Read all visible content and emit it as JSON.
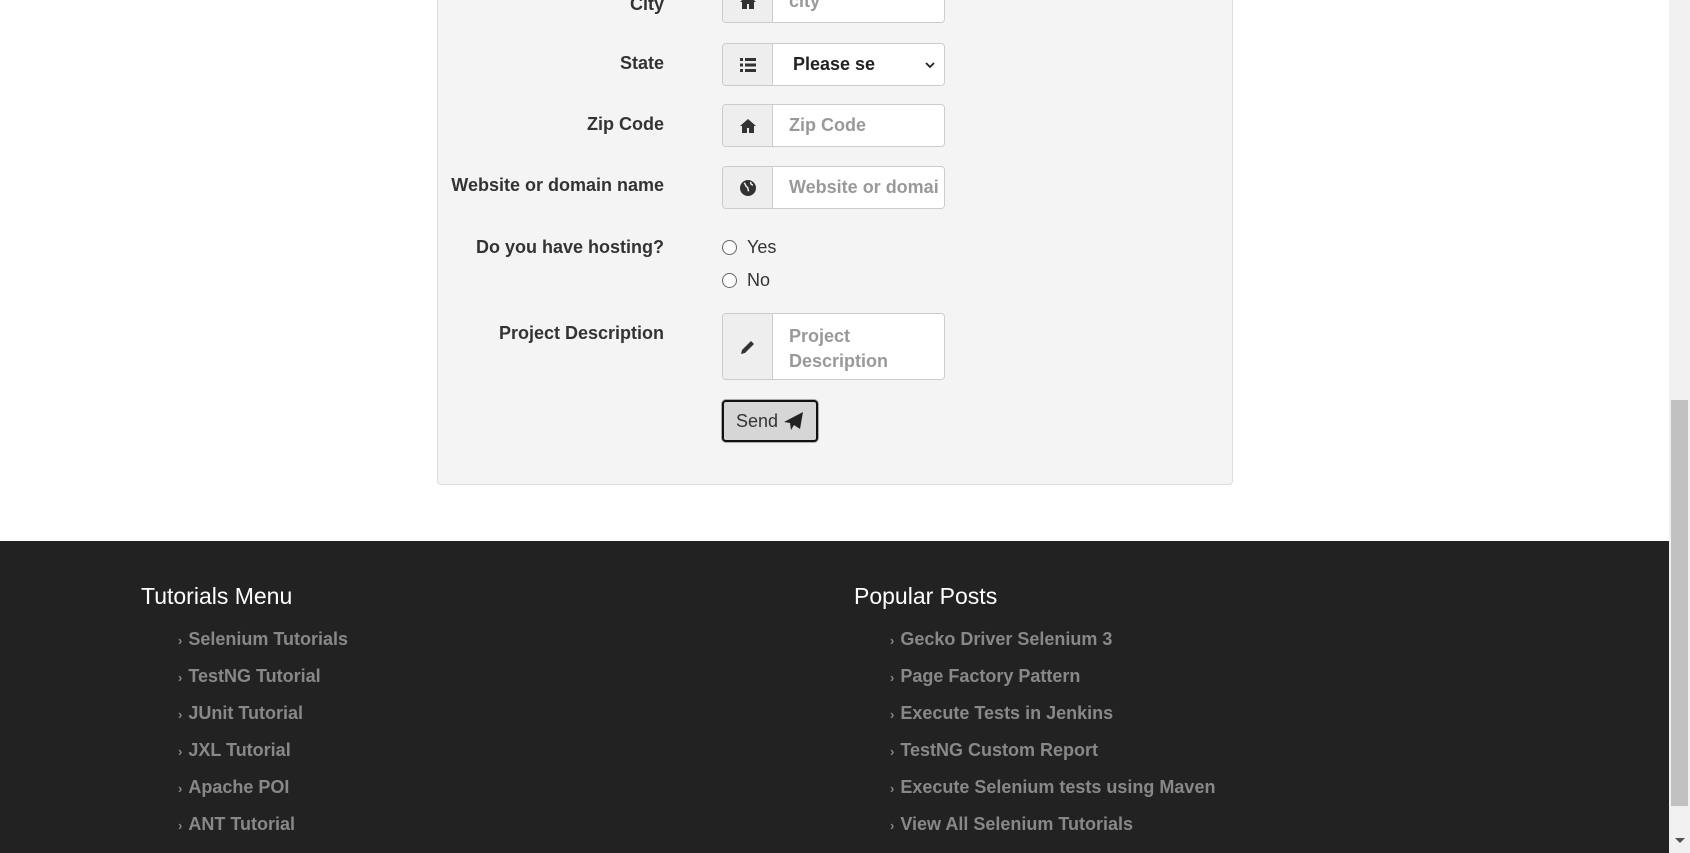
{
  "form": {
    "city": {
      "label": "City",
      "placeholder": "city"
    },
    "state": {
      "label": "State",
      "value": "Please se"
    },
    "zip": {
      "label": "Zip Code",
      "placeholder": "Zip Code"
    },
    "website": {
      "label": "Website or domain name",
      "placeholder": "Website or domai"
    },
    "hosting": {
      "label": "Do you have hosting?",
      "options": [
        "Yes",
        "No"
      ]
    },
    "description": {
      "label": "Project Description",
      "placeholder": "Project Description"
    },
    "send_label": "Send"
  },
  "footer": {
    "tutorials": {
      "title": "Tutorials Menu",
      "items": [
        "Selenium Tutorials",
        "TestNG Tutorial",
        "JUnit Tutorial",
        "JXL Tutorial",
        "Apache POI",
        "ANT Tutorial"
      ]
    },
    "popular": {
      "title": "Popular Posts",
      "items": [
        "Gecko Driver Selenium 3",
        "Page Factory Pattern",
        "Execute Tests in Jenkins",
        "TestNG Custom Report",
        "Execute Selenium tests using Maven",
        "View All Selenium Tutorials"
      ]
    }
  }
}
